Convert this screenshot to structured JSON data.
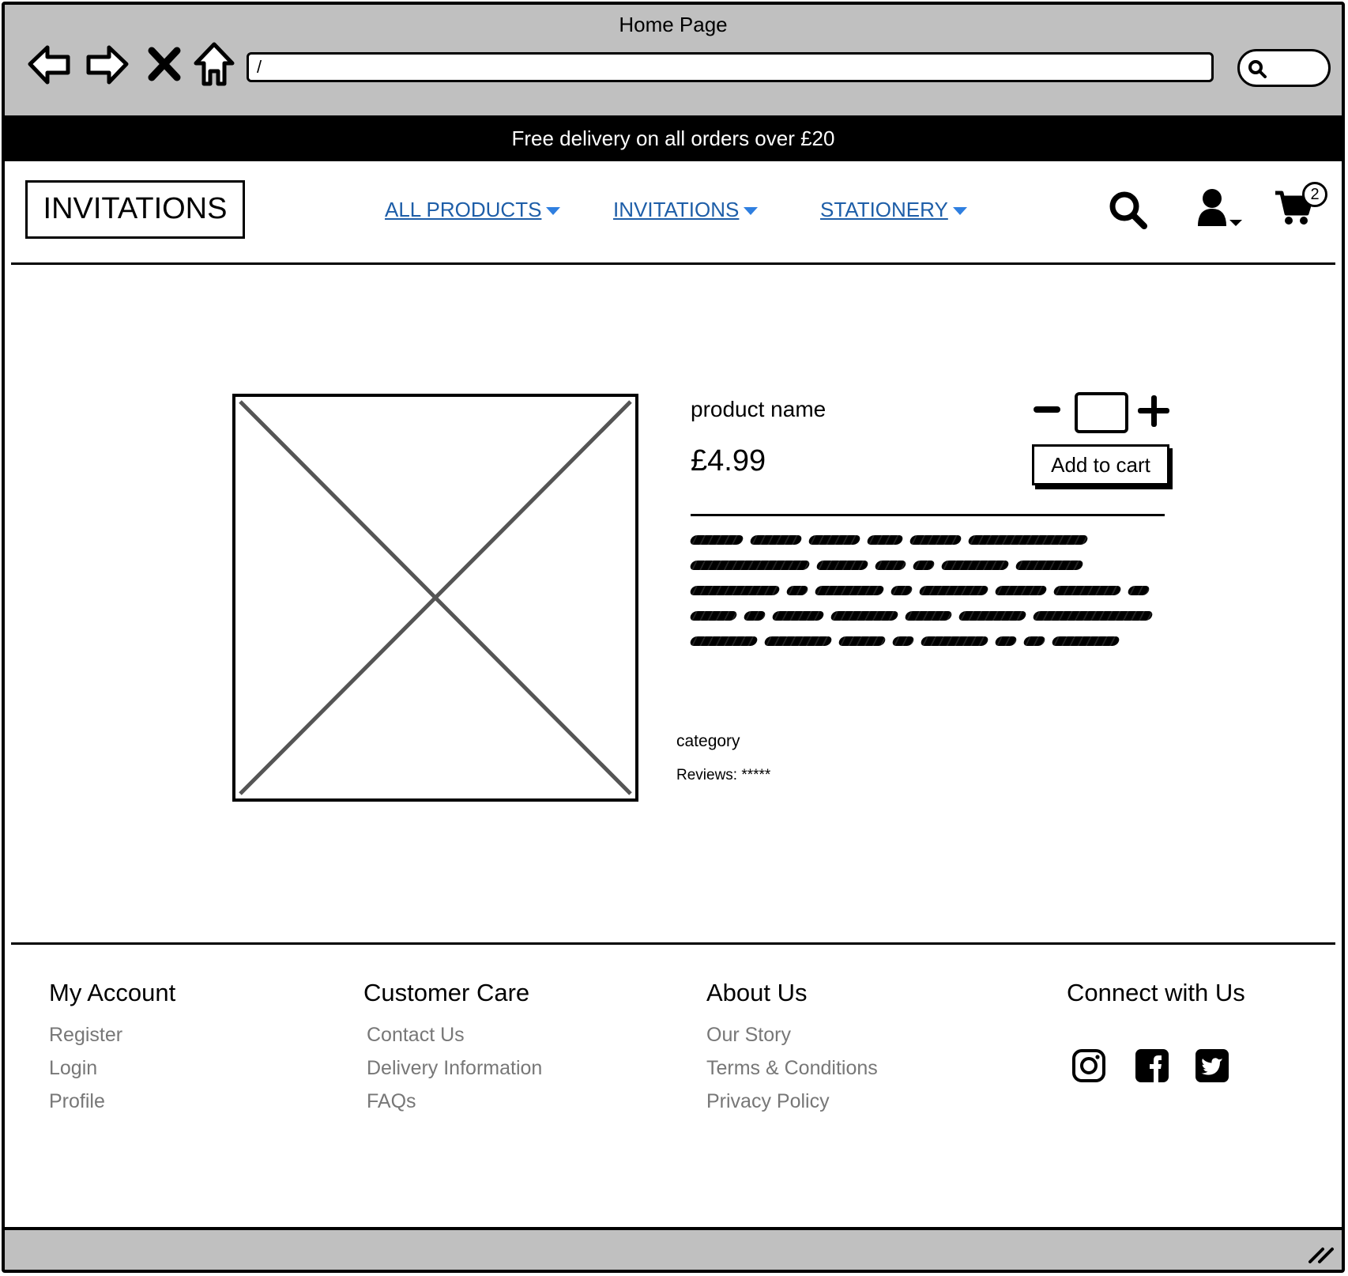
{
  "browser": {
    "title": "Home Page",
    "url": "/"
  },
  "promo": {
    "text": "Free delivery on all orders over £20"
  },
  "header": {
    "logo": "INVITATIONS",
    "nav": [
      {
        "label": "ALL PRODUCTS"
      },
      {
        "label": "INVITATIONS"
      },
      {
        "label": "STATIONERY"
      }
    ],
    "cart_count": "2"
  },
  "product": {
    "name": "product name",
    "price": "£4.99",
    "add_to_cart_label": "Add to cart",
    "quantity": "",
    "category": "category",
    "reviews": "Reviews: *****"
  },
  "footer": {
    "account": {
      "heading": "My Account",
      "links": [
        "Register",
        "Login",
        "Profile"
      ]
    },
    "care": {
      "heading": "Customer Care",
      "links": [
        "Contact Us",
        "Delivery Information",
        "FAQs"
      ]
    },
    "about": {
      "heading": "About Us",
      "links": [
        "Our Story",
        "Terms & Conditions",
        "Privacy Policy"
      ]
    },
    "connect": {
      "heading": "Connect with Us"
    }
  },
  "icons": {
    "back": "arrow-left-icon",
    "forward": "arrow-right-icon",
    "stop": "close-icon",
    "home": "home-icon",
    "search": "search-icon",
    "account": "user-icon",
    "cart": "cart-icon",
    "social": [
      "instagram-icon",
      "facebook-icon",
      "twitter-icon"
    ]
  },
  "colors": {
    "link": "#1e5ea8",
    "caret": "#2f7fe0",
    "chrome": "#c0c0c0",
    "footer_link": "#777777"
  }
}
